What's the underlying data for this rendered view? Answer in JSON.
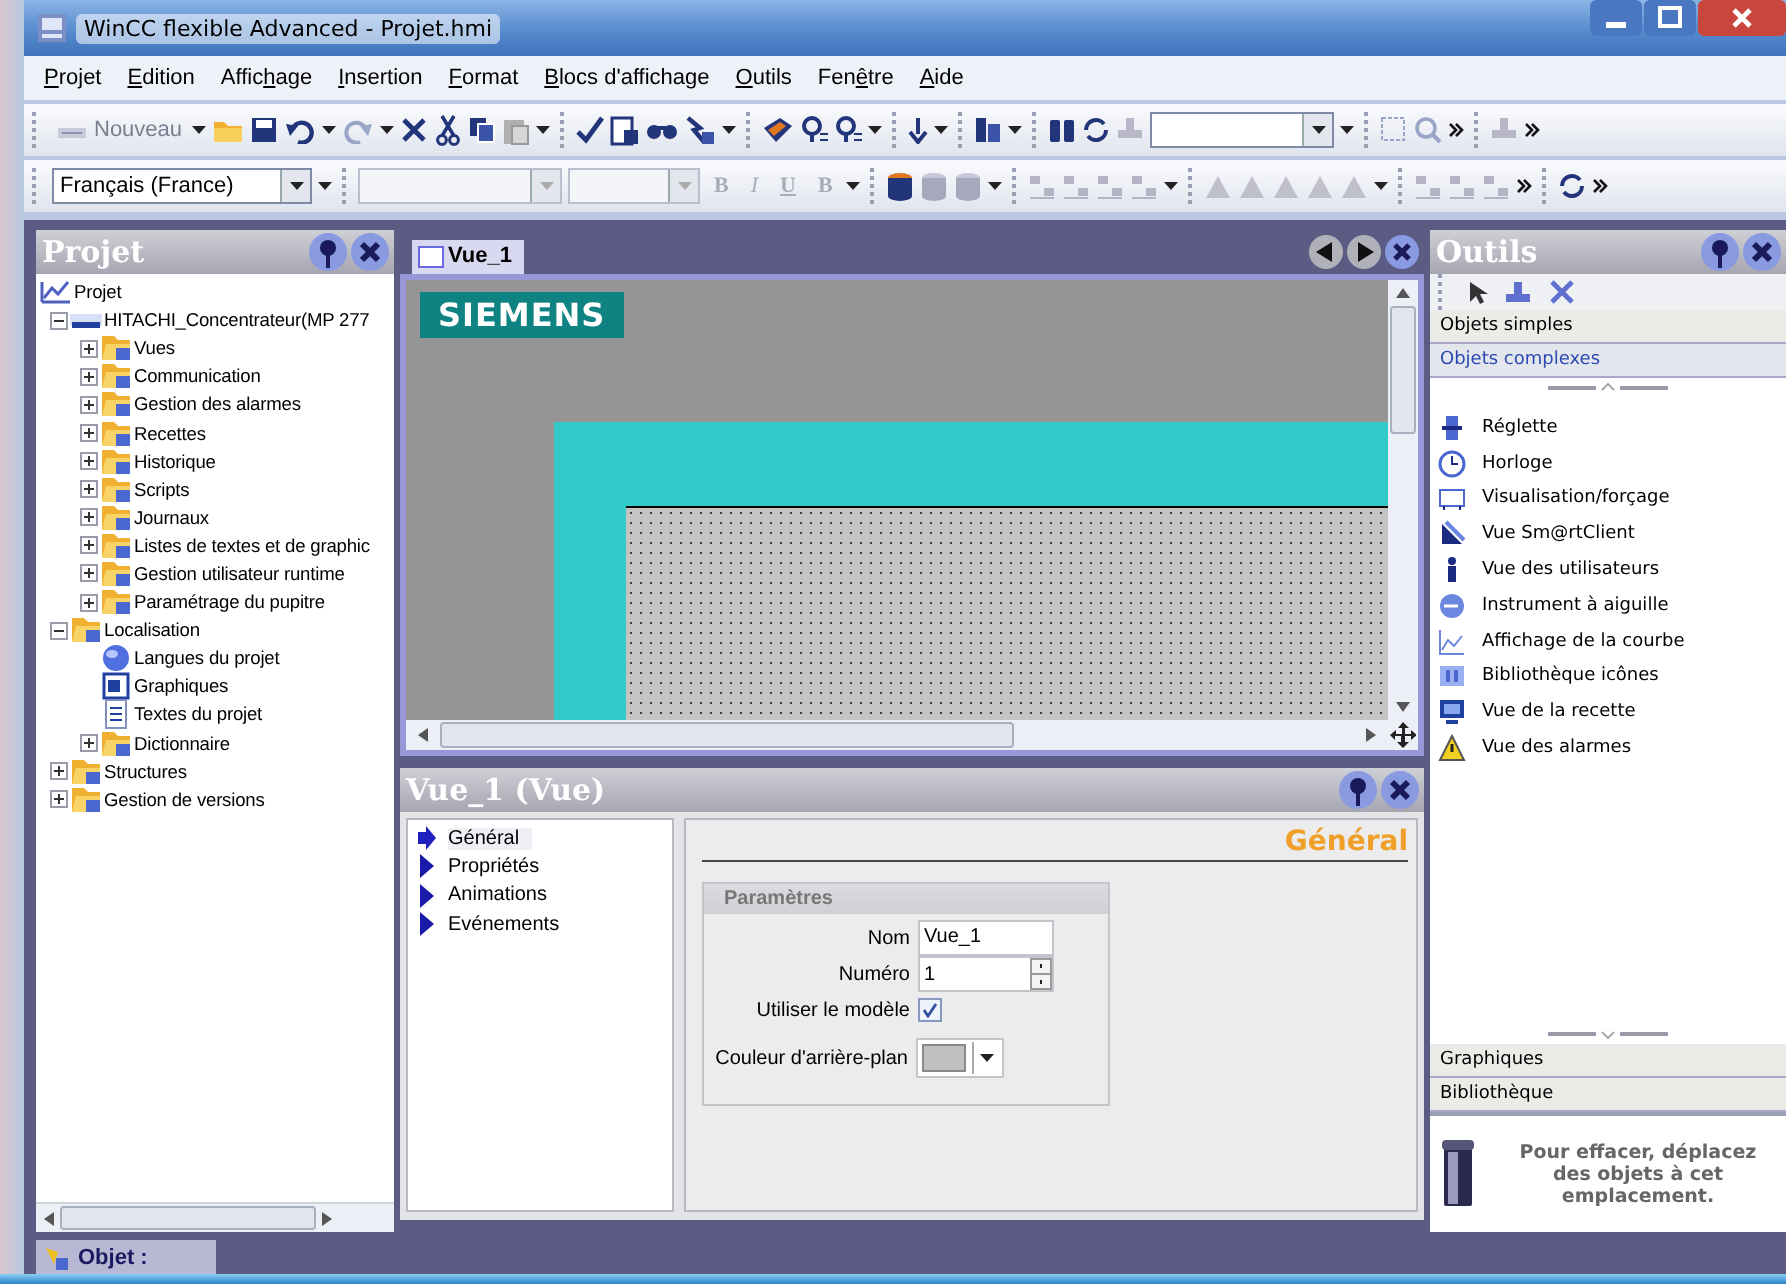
{
  "window": {
    "title": "WinCC flexible Advanced - Projet.hmi"
  },
  "menu": [
    {
      "mnemonic": "P",
      "rest": "rojet"
    },
    {
      "mnemonic": "E",
      "rest": "dition"
    },
    {
      "before": "Affic",
      "mnemonic": "h",
      "rest": "age"
    },
    {
      "mnemonic": "I",
      "rest": "nsertion"
    },
    {
      "mnemonic": "F",
      "rest": "ormat"
    },
    {
      "mnemonic": "B",
      "rest": "locs d'affichage"
    },
    {
      "mnemonic": "O",
      "rest": "utils"
    },
    {
      "before": "Fen",
      "mnemonic": "ê",
      "rest": "tre"
    },
    {
      "mnemonic": "A",
      "rest": "ide"
    }
  ],
  "toolbar": {
    "new_button": {
      "label": "Nouveau",
      "disabled": true
    },
    "language": "Français (France)",
    "format_buttons": [
      {
        "label": "B",
        "disabled": true
      },
      {
        "label": "I",
        "disabled": true
      },
      {
        "label": "U",
        "disabled": true
      },
      {
        "label": "B",
        "disabled": true
      }
    ]
  },
  "project_panel": {
    "title": "Projet",
    "tree": [
      {
        "label": "Projet",
        "kind": "project",
        "children": [
          {
            "label": "HITACHI_Concentrateur(MP 277",
            "kind": "device",
            "expanded": true,
            "children": [
              {
                "label": "Vues",
                "kind": "folder",
                "expanded": false
              },
              {
                "label": "Communication",
                "kind": "folder",
                "expanded": false
              },
              {
                "label": "Gestion des alarmes",
                "kind": "folder",
                "expanded": false
              },
              {
                "label": "Recettes",
                "kind": "folder",
                "expanded": false
              },
              {
                "label": "Historique",
                "kind": "folder",
                "expanded": false
              },
              {
                "label": "Scripts",
                "kind": "folder",
                "expanded": false
              },
              {
                "label": "Journaux",
                "kind": "folder",
                "expanded": false
              },
              {
                "label": "Listes de textes et de graphic",
                "kind": "folder",
                "expanded": false
              },
              {
                "label": "Gestion utilisateur runtime",
                "kind": "folder",
                "expanded": false
              },
              {
                "label": "Paramétrage du pupitre",
                "kind": "folder",
                "expanded": false
              }
            ]
          },
          {
            "label": "Localisation",
            "kind": "folder",
            "expanded": true,
            "children": [
              {
                "label": "Langues du projet",
                "kind": "globe"
              },
              {
                "label": "Graphiques",
                "kind": "image"
              },
              {
                "label": "Textes du projet",
                "kind": "document"
              },
              {
                "label": "Dictionnaire",
                "kind": "folder",
                "expanded": false
              }
            ]
          },
          {
            "label": "Structures",
            "kind": "folder",
            "expanded": false
          },
          {
            "label": "Gestion de versions",
            "kind": "folder",
            "expanded": false
          }
        ]
      }
    ]
  },
  "editor": {
    "tabs": [
      {
        "label": "Vue_1",
        "selected": true
      }
    ],
    "logo": "SIEMENS"
  },
  "properties": {
    "title": "Vue_1 (Vue)",
    "nav": [
      {
        "label": "Général",
        "selected": true
      },
      {
        "label": "Propriétés",
        "selected": false
      },
      {
        "label": "Animations",
        "selected": false
      },
      {
        "label": "Evénements",
        "selected": false
      }
    ],
    "heading": "Général",
    "group": {
      "title": "Paramètres",
      "fields": [
        {
          "kind": "text",
          "label": "Nom",
          "value": "Vue_1"
        },
        {
          "kind": "spin",
          "label": "Numéro",
          "value": "1"
        },
        {
          "kind": "checkbox",
          "label": "Utiliser le modèle",
          "checked": true
        },
        {
          "kind": "color",
          "label": "Couleur d'arrière-plan",
          "color": "#c0c0c0"
        }
      ]
    }
  },
  "tools": {
    "title": "Outils",
    "sections": [
      {
        "label": "Objets simples",
        "selected": false
      },
      {
        "label": "Objets complexes",
        "selected": true
      }
    ],
    "items": [
      {
        "label": "Réglette",
        "kind": "slider"
      },
      {
        "label": "Horloge",
        "kind": "clock"
      },
      {
        "label": "Visualisation/forçage",
        "kind": "display"
      },
      {
        "label": "Vue Sm@rtClient",
        "kind": "client"
      },
      {
        "label": "Vue des utilisateurs",
        "kind": "user"
      },
      {
        "label": "Instrument à aiguille",
        "kind": "gauge"
      },
      {
        "label": "Affichage de la courbe",
        "kind": "trend"
      },
      {
        "label": "Bibliothèque icônes",
        "kind": "library"
      },
      {
        "label": "Vue de la recette",
        "kind": "recipe"
      },
      {
        "label": "Vue des alarmes",
        "kind": "alarm"
      }
    ],
    "bottom_sections": [
      {
        "label": "Graphiques"
      },
      {
        "label": "Bibliothèque"
      }
    ],
    "trash_hint": "Pour effacer, déplacez des objets à cet emplacement."
  },
  "status_bar": {
    "tab": "Objet :"
  }
}
